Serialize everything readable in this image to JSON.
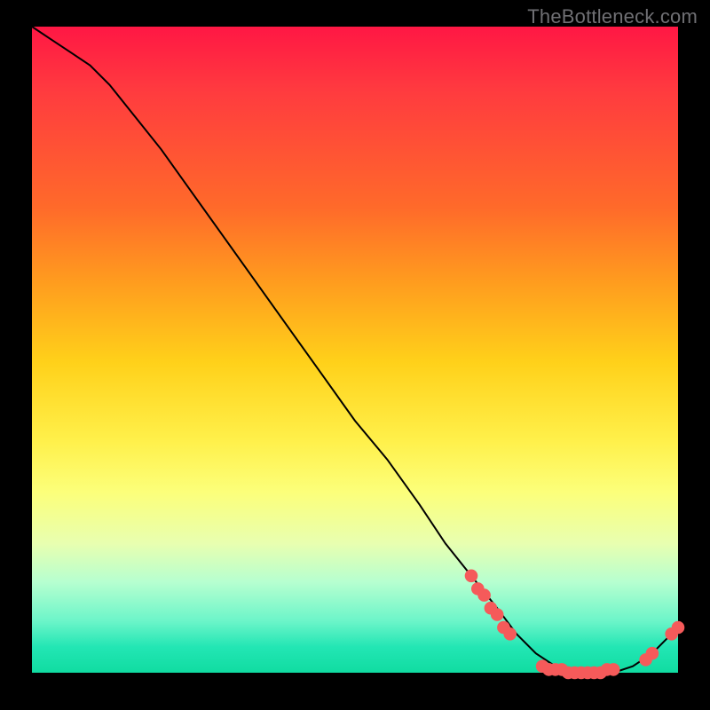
{
  "watermark": "TheBottleneck.com",
  "colors": {
    "curve": "#000000",
    "marker": "#f55a5a",
    "gradient_top": "#ff1744",
    "gradient_bottom": "#10dca1"
  },
  "chart_data": {
    "type": "line",
    "title": "",
    "xlabel": "",
    "ylabel": "",
    "xlim": [
      0,
      100
    ],
    "ylim": [
      0,
      100
    ],
    "grid": false,
    "axes_visible": false,
    "legend": null,
    "series": [
      {
        "name": "bottleneck-curve",
        "color": "#000000",
        "x": [
          0,
          3,
          6,
          9,
          12,
          16,
          20,
          25,
          30,
          35,
          40,
          45,
          50,
          55,
          60,
          64,
          68,
          72,
          75,
          78,
          81,
          84,
          87,
          90,
          93,
          96,
          98,
          100
        ],
        "y": [
          100,
          98,
          96,
          94,
          91,
          86,
          81,
          74,
          67,
          60,
          53,
          46,
          39,
          33,
          26,
          20,
          15,
          10,
          6,
          3,
          1,
          0,
          0,
          0,
          1,
          3,
          5,
          7
        ]
      }
    ],
    "markers": {
      "name": "dense-region",
      "color": "#f55a5a",
      "radius": 1.0,
      "points": [
        {
          "x": 68,
          "y": 15
        },
        {
          "x": 69,
          "y": 13
        },
        {
          "x": 70,
          "y": 12
        },
        {
          "x": 71,
          "y": 10
        },
        {
          "x": 72,
          "y": 9
        },
        {
          "x": 73,
          "y": 7
        },
        {
          "x": 74,
          "y": 6
        },
        {
          "x": 79,
          "y": 1
        },
        {
          "x": 80,
          "y": 0.5
        },
        {
          "x": 81,
          "y": 0.5
        },
        {
          "x": 82,
          "y": 0.5
        },
        {
          "x": 83,
          "y": 0
        },
        {
          "x": 84,
          "y": 0
        },
        {
          "x": 85,
          "y": 0
        },
        {
          "x": 86,
          "y": 0
        },
        {
          "x": 87,
          "y": 0
        },
        {
          "x": 88,
          "y": 0
        },
        {
          "x": 89,
          "y": 0.5
        },
        {
          "x": 90,
          "y": 0.5
        },
        {
          "x": 95,
          "y": 2
        },
        {
          "x": 96,
          "y": 3
        },
        {
          "x": 99,
          "y": 6
        },
        {
          "x": 100,
          "y": 7
        }
      ]
    }
  }
}
